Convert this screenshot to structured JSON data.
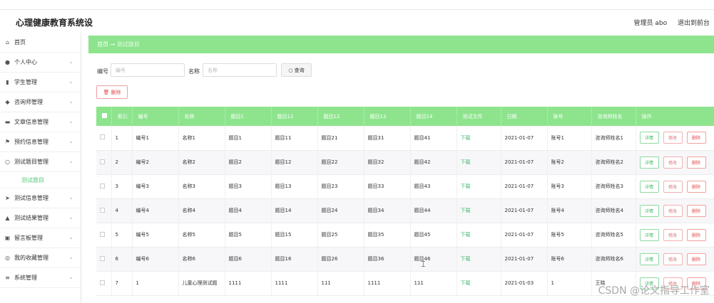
{
  "header": {
    "brand": "心理健康教育系统设",
    "user_label": "管理员 abo",
    "exit_label": "退出到前台"
  },
  "sidebar": {
    "items": [
      {
        "icon": "home-icon",
        "glyph": "⌂",
        "label": "首页",
        "expandable": false
      },
      {
        "icon": "user-icon",
        "glyph": "●",
        "label": "个人中心",
        "expandable": true
      },
      {
        "icon": "bar-chart-icon",
        "glyph": "▮",
        "label": "学生管理",
        "expandable": true
      },
      {
        "icon": "location-icon",
        "glyph": "◆",
        "label": "咨询师管理",
        "expandable": true
      },
      {
        "icon": "document-icon",
        "glyph": "▬",
        "label": "文章信息管理",
        "expandable": true
      },
      {
        "icon": "flag-icon",
        "glyph": "⚑",
        "label": "预约信息管理",
        "expandable": true
      },
      {
        "icon": "power-icon",
        "glyph": "○",
        "label": "测试题目管理",
        "expandable": true
      }
    ],
    "sub_item": "测试题目",
    "items_after": [
      {
        "icon": "send-icon",
        "glyph": "➤",
        "label": "测试信息管理",
        "expandable": true
      },
      {
        "icon": "chart-icon",
        "glyph": "▲",
        "label": "测试结果管理",
        "expandable": true
      },
      {
        "icon": "message-icon",
        "glyph": "▣",
        "label": "留言板管理",
        "expandable": true
      },
      {
        "icon": "favorite-icon",
        "glyph": "◎",
        "label": "我的收藏管理",
        "expandable": true
      },
      {
        "icon": "settings-icon",
        "glyph": "≡",
        "label": "系统管理",
        "expandable": true
      }
    ]
  },
  "breadcrumb": {
    "home": "首页",
    "arrow": "→",
    "current": "测试题目"
  },
  "search": {
    "field1_label": "编号",
    "field1_placeholder": "编号",
    "field2_label": "名称",
    "field2_placeholder": "名称",
    "button_label": "○ 查询"
  },
  "delete_button": "🗑 删除",
  "table": {
    "headers": [
      "",
      "索引",
      "编号",
      "名称",
      "题目1",
      "题目11",
      "题目12",
      "题目13",
      "题目14",
      "测试文件",
      "日期",
      "账号",
      "咨询师姓名",
      "操作"
    ],
    "rows": [
      [
        "1",
        "编号1",
        "名称1",
        "题目1",
        "题目11",
        "题目21",
        "题目31",
        "题目41",
        "下载",
        "2021-01-07",
        "账号1",
        "咨询师姓名1"
      ],
      [
        "2",
        "编号2",
        "名称2",
        "题目2",
        "题目12",
        "题目22",
        "题目32",
        "题目42",
        "下载",
        "2021-01-07",
        "账号2",
        "咨询师姓名2"
      ],
      [
        "3",
        "编号3",
        "名称3",
        "题目3",
        "题目13",
        "题目23",
        "题目33",
        "题目43",
        "下载",
        "2021-01-07",
        "账号3",
        "咨询师姓名3"
      ],
      [
        "4",
        "编号4",
        "名称4",
        "题目4",
        "题目14",
        "题目24",
        "题目34",
        "题目44",
        "下载",
        "2021-01-07",
        "账号4",
        "咨询师姓名4"
      ],
      [
        "5",
        "编号5",
        "名称5",
        "题目5",
        "题目15",
        "题目25",
        "题目35",
        "题目45",
        "下载",
        "2021-01-07",
        "账号5",
        "咨询师姓名5"
      ],
      [
        "6",
        "编号6",
        "名称6",
        "题目6",
        "题目16",
        "题目26",
        "题目36",
        "题目46",
        "下载",
        "2021-01-07",
        "账号6",
        "咨询师姓名6"
      ],
      [
        "7",
        "1",
        "儿童心理测试题",
        "1111",
        "1111",
        "111",
        "1111",
        "111",
        "下载",
        "2021-01-03",
        "1",
        "王晓"
      ]
    ],
    "actions": {
      "detail": "详情",
      "edit": "修改",
      "delete": "删除"
    }
  },
  "watermark": "CSDN @论文指导工作室",
  "colors": {
    "accent": "#8de48d",
    "link": "#3fb86a",
    "danger": "#e05050"
  }
}
